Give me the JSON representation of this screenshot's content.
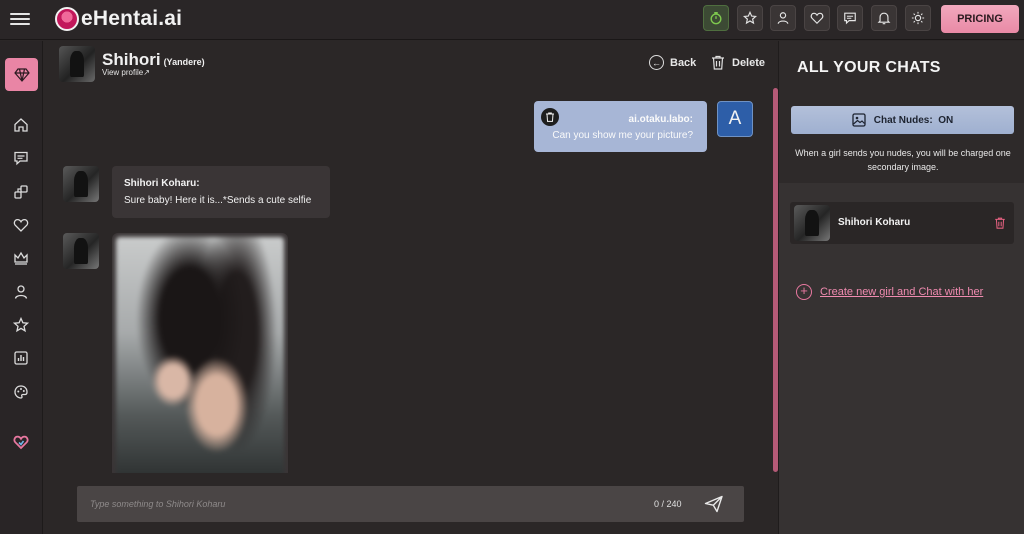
{
  "app": {
    "logo_text": "eHentai.ai"
  },
  "topbar": {
    "pricing_label": "PRICING"
  },
  "chat_header": {
    "name": "Shihori",
    "tag": "(Yandere)",
    "view_profile": "View profile",
    "back_label": "Back",
    "delete_label": "Delete"
  },
  "messages": {
    "user": {
      "name": "ai.otaku.labo:",
      "text": "Can you show me your picture?",
      "avatar_letter": "A"
    },
    "bot": {
      "name": "Shihori Koharu:",
      "text": "Sure baby! Here it is...*Sends a cute selfie"
    }
  },
  "input": {
    "placeholder": "Type something to Shihori Koharu",
    "counter": "0 / 240"
  },
  "right_panel": {
    "title": "ALL YOUR CHATS",
    "nudes_button": "Chat Nudes:  ON",
    "nudes_note": "When a girl sends you nudes, you will be charged one secondary image.",
    "chats": [
      {
        "name": "Shihori Koharu"
      }
    ],
    "create_link": "Create new girl and Chat with her"
  },
  "colors": {
    "accent_pink": "#e985a5",
    "user_bubble": "#a7b6d6",
    "background": "#2b2727"
  }
}
